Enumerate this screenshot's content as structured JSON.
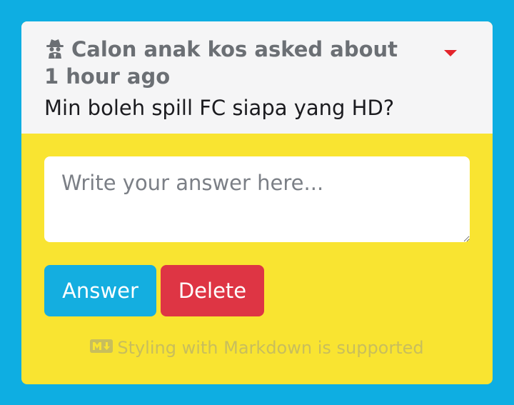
{
  "question_card": {
    "asker_line": "Calon anak kos asked about 1 hour ago",
    "asker_icon": "spy-icon",
    "caret_icon": "caret-down-icon",
    "question_text": "Min boleh spill FC siapa yang HD?"
  },
  "answer_form": {
    "placeholder": "Write your answer here...",
    "value": "",
    "answer_label": "Answer",
    "delete_label": "Delete",
    "markdown_note": "Styling with Markdown is supported",
    "markdown_icon": "markdown-icon"
  },
  "colors": {
    "page_background": "#0eaee2",
    "card_body": "#f9e431",
    "card_header": "#f5f5f6",
    "answer_button": "#14aee0",
    "delete_button": "#de3544",
    "caret": "#e3242b"
  }
}
